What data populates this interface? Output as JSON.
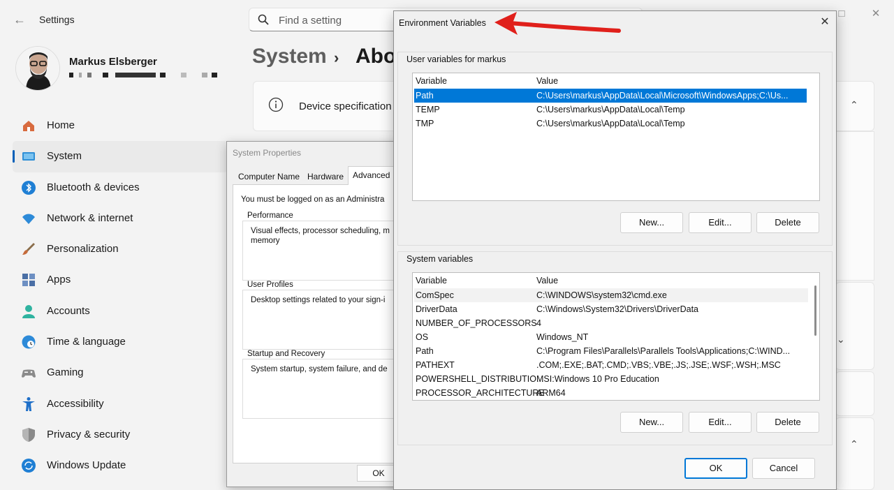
{
  "settings": {
    "app_title": "Settings",
    "search_placeholder": "Find a setting",
    "user": {
      "name": "Markus Elsberger"
    },
    "nav": [
      {
        "label": "Home",
        "icon": "home-icon",
        "color": "#d86b3f"
      },
      {
        "label": "System",
        "icon": "system-icon",
        "color": "#2f8fd6",
        "active": true
      },
      {
        "label": "Bluetooth & devices",
        "icon": "bluetooth-icon",
        "color": "#1f7fd4"
      },
      {
        "label": "Network & internet",
        "icon": "network-icon",
        "color": "#2d8ad8"
      },
      {
        "label": "Personalization",
        "icon": "brush-icon",
        "color": "#c56a3a"
      },
      {
        "label": "Apps",
        "icon": "apps-icon",
        "color": "#4a6fa5"
      },
      {
        "label": "Accounts",
        "icon": "accounts-icon",
        "color": "#2fb3a0"
      },
      {
        "label": "Time & language",
        "icon": "clock-globe-icon",
        "color": "#2d8ad8"
      },
      {
        "label": "Gaming",
        "icon": "gamepad-icon",
        "color": "#8a8a8a"
      },
      {
        "label": "Accessibility",
        "icon": "accessibility-icon",
        "color": "#1f6fc8"
      },
      {
        "label": "Privacy & security",
        "icon": "shield-icon",
        "color": "#8a8a8a"
      },
      {
        "label": "Windows Update",
        "icon": "update-icon",
        "color": "#1f7fd4"
      }
    ],
    "breadcrumb": {
      "parent": "System",
      "current": "Abo"
    },
    "device_spec_title": "Device specification"
  },
  "system_properties": {
    "title": "System Properties",
    "tabs": [
      "Computer Name",
      "Hardware",
      "Advanced"
    ],
    "active_tab": "Advanced",
    "warning": "You must be logged on as an Administra",
    "groups": [
      {
        "label": "Performance",
        "lines": [
          "Visual effects, processor scheduling, m",
          "memory"
        ]
      },
      {
        "label": "User Profiles",
        "lines": [
          "Desktop settings related to your sign-i"
        ]
      },
      {
        "label": "Startup and Recovery",
        "lines": [
          "System startup, system failure, and de"
        ]
      }
    ],
    "ok_label": "OK"
  },
  "env_vars": {
    "title": "Environment Variables",
    "user_section_label": "User variables for markus",
    "system_section_label": "System variables",
    "col_variable": "Variable",
    "col_value": "Value",
    "user_vars": [
      {
        "name": "Path",
        "value": "C:\\Users\\markus\\AppData\\Local\\Microsoft\\WindowsApps;C:\\Us...",
        "selected": true
      },
      {
        "name": "TEMP",
        "value": "C:\\Users\\markus\\AppData\\Local\\Temp"
      },
      {
        "name": "TMP",
        "value": "C:\\Users\\markus\\AppData\\Local\\Temp"
      }
    ],
    "system_vars": [
      {
        "name": "ComSpec",
        "value": "C:\\WINDOWS\\system32\\cmd.exe"
      },
      {
        "name": "DriverData",
        "value": "C:\\Windows\\System32\\Drivers\\DriverData"
      },
      {
        "name": "NUMBER_OF_PROCESSORS",
        "value": "4"
      },
      {
        "name": "OS",
        "value": "Windows_NT"
      },
      {
        "name": "Path",
        "value": "C:\\Program Files\\Parallels\\Parallels Tools\\Applications;C:\\WIND..."
      },
      {
        "name": "PATHEXT",
        "value": ".COM;.EXE;.BAT;.CMD;.VBS;.VBE;.JS;.JSE;.WSF;.WSH;.MSC"
      },
      {
        "name": "POWERSHELL_DISTRIBUTIO...",
        "value": "MSI:Windows 10 Pro Education"
      },
      {
        "name": "PROCESSOR_ARCHITECTURE",
        "value": "ARM64"
      }
    ],
    "buttons": {
      "new": "New...",
      "edit": "Edit...",
      "delete": "Delete",
      "ok": "OK",
      "cancel": "Cancel"
    },
    "accent_color": "#0078d7",
    "annotation_color": "#e0201b"
  }
}
